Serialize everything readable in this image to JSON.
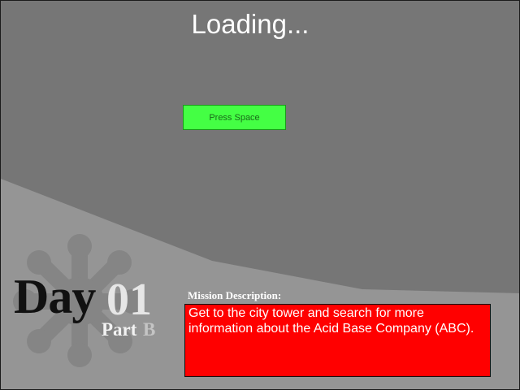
{
  "screen": {
    "loading_text": "Loading...",
    "press_space_label": "Press Space"
  },
  "day_badge": {
    "day_word": "Day",
    "day_number": "01",
    "part_word": "Part",
    "part_letter": "B",
    "emblem_icon": "gear-emblem-icon"
  },
  "mission": {
    "label": "Mission Description:",
    "description": "Get to the city tower and search for more information about the Acid Base Company (ABC)."
  },
  "colors": {
    "background_dark": "#767676",
    "background_light": "#959595",
    "button_green": "#44ff44",
    "mission_red": "#ff0000"
  }
}
